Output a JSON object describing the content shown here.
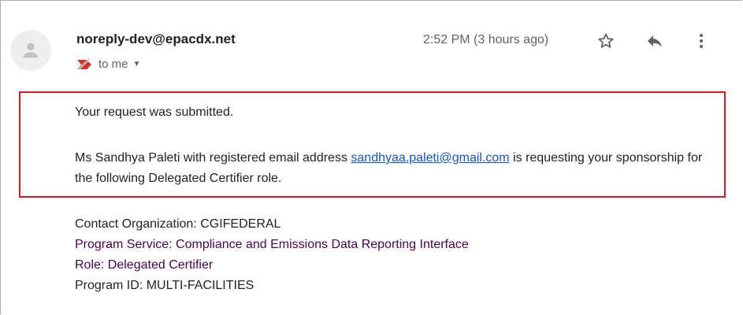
{
  "email": {
    "sender": "noreply-dev@epacdx.net",
    "recipient_label": "to me",
    "time": "2:52 PM (3 hours ago)",
    "icons": {
      "avatar": "person-icon",
      "important": "important-marker-icon",
      "caret": "chevron-down-icon",
      "star": "star-icon",
      "reply": "reply-icon",
      "more": "more-vert-icon"
    },
    "highlight_color": "#e2151b",
    "body": {
      "line1": "Your request was submitted.",
      "p2_before": "Ms Sandhya Paleti with registered email address ",
      "p2_link": "sandhyaa.paleti@gmail.com",
      "p2_after": " is requesting your sponsorship for the following Delegated Certifier role."
    },
    "details": {
      "contact_org": "Contact Organization: CGIFEDERAL",
      "program_service": "Program Service: Compliance and Emissions Data Reporting Interface",
      "role": "Role: Delegated Certifier",
      "program_id": "Program ID: MULTI-FACILITIES"
    }
  }
}
